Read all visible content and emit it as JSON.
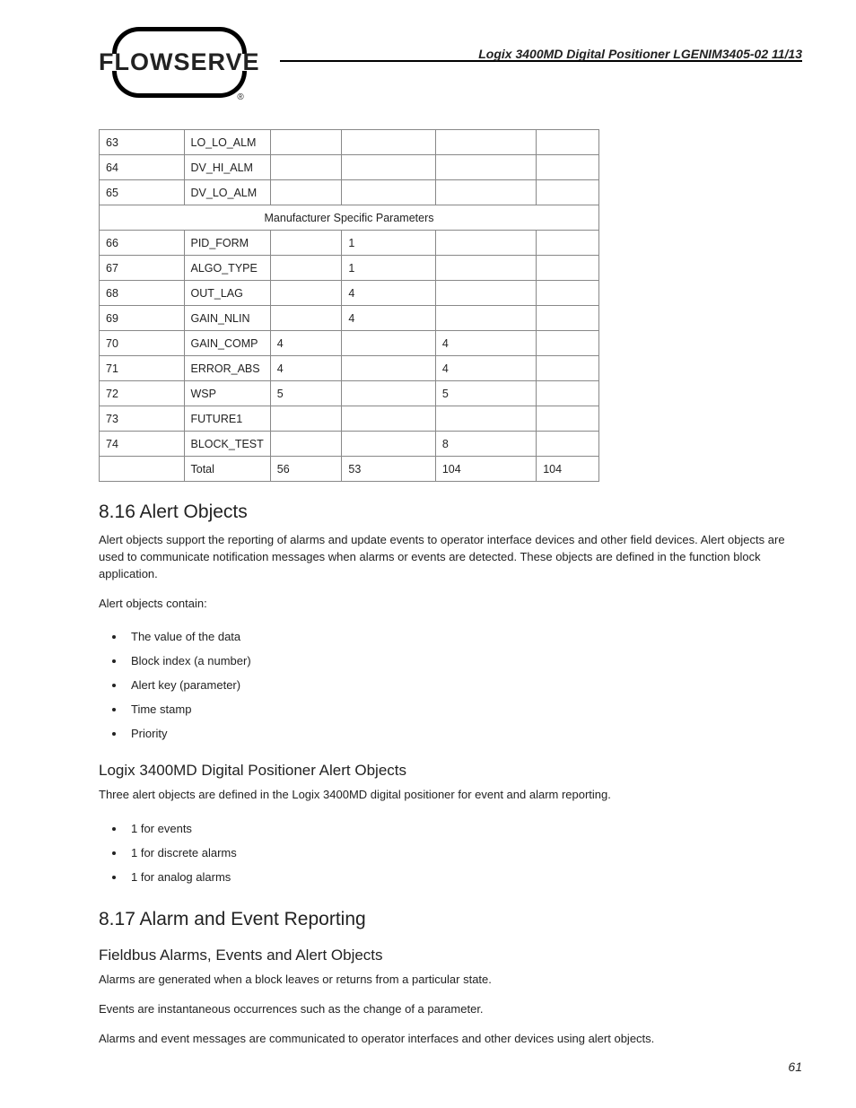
{
  "header": {
    "brand": "FLOWSERVE",
    "doc_title": "Logix 3400MD Digital Positioner LGENIM3405-02 11/13"
  },
  "table": {
    "rows_top": [
      {
        "n": "63",
        "name": "LO_LO_ALM",
        "c3": "",
        "c4": "",
        "c5": "",
        "c6": ""
      },
      {
        "n": "64",
        "name": "DV_HI_ALM",
        "c3": "",
        "c4": "",
        "c5": "",
        "c6": ""
      },
      {
        "n": "65",
        "name": "DV_LO_ALM",
        "c3": "",
        "c4": "",
        "c5": "",
        "c6": ""
      }
    ],
    "section_header": "Manufacturer Specific Parameters",
    "rows_bottom": [
      {
        "n": "66",
        "name": "PID_FORM",
        "c3": "",
        "c4": "1",
        "c5": "",
        "c6": ""
      },
      {
        "n": "67",
        "name": "ALGO_TYPE",
        "c3": "",
        "c4": "1",
        "c5": "",
        "c6": ""
      },
      {
        "n": "68",
        "name": "OUT_LAG",
        "c3": "",
        "c4": "4",
        "c5": "",
        "c6": ""
      },
      {
        "n": "69",
        "name": "GAIN_NLIN",
        "c3": "",
        "c4": "4",
        "c5": "",
        "c6": ""
      },
      {
        "n": "70",
        "name": "GAIN_COMP",
        "c3": "4",
        "c4": "",
        "c5": "4",
        "c6": ""
      },
      {
        "n": "71",
        "name": "ERROR_ABS",
        "c3": "4",
        "c4": "",
        "c5": "4",
        "c6": ""
      },
      {
        "n": "72",
        "name": "WSP",
        "c3": "5",
        "c4": "",
        "c5": "5",
        "c6": ""
      },
      {
        "n": "73",
        "name": "FUTURE1",
        "c3": "",
        "c4": "",
        "c5": "",
        "c6": ""
      },
      {
        "n": "74",
        "name": "BLOCK_TEST",
        "c3": "",
        "c4": "",
        "c5": "8",
        "c6": ""
      }
    ],
    "total": {
      "label": "Total",
      "c3": "56",
      "c4": "53",
      "c5": "104",
      "c6": "104"
    }
  },
  "sections": {
    "s1": {
      "heading": "8.16   Alert Objects",
      "p1": "Alert objects support the reporting of alarms and update events to operator interface devices and other field devices.  Alert objects are used to communicate notification messages when alarms or events are detected.  These objects are defined in the function block application.",
      "p2": "Alert objects contain:",
      "list1": [
        "The value of the data",
        "Block index (a number)",
        "Alert key (parameter)",
        "Time stamp",
        "Priority"
      ],
      "sub1": "Logix 3400MD Digital Positioner Alert Objects",
      "p3": "Three alert objects are defined in the Logix 3400MD digital positioner for event and alarm reporting.",
      "list2": [
        "1 for events",
        "1 for discrete alarms",
        "1 for analog alarms"
      ]
    },
    "s2": {
      "heading": "8.17   Alarm and Event Reporting",
      "sub1": "Fieldbus Alarms, Events and Alert Objects",
      "p1": "Alarms are generated when a block leaves or returns from a particular state.",
      "p2": "Events are instantaneous occurrences such as the change of a parameter.",
      "p3": "Alarms and event messages are communicated to operator interfaces and other devices using alert objects."
    }
  },
  "page_number": "61"
}
